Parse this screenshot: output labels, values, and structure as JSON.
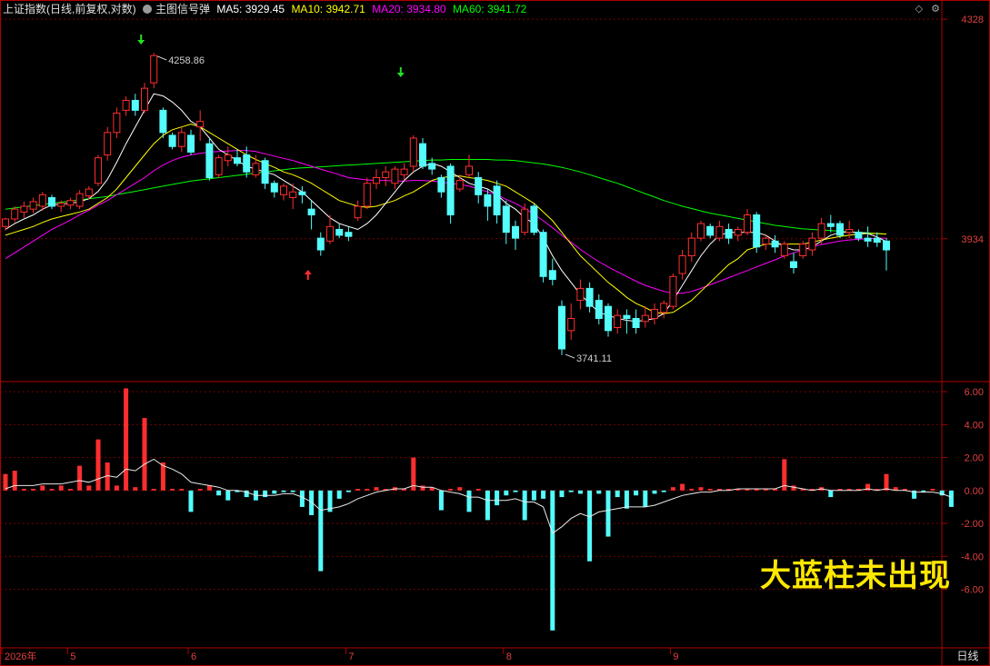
{
  "header": {
    "title": "上证指数(日线,前复权,对数)",
    "indicator_name": "主图信号弹",
    "ma": [
      {
        "label": "MA5: 3929.45",
        "color": "#ffffff"
      },
      {
        "label": "MA10: 3942.71",
        "color": "#ffff00"
      },
      {
        "label": "MA20: 3934.80",
        "color": "#ff00ff"
      },
      {
        "label": "MA60: 3941.72",
        "color": "#00ff00"
      }
    ],
    "tool_icons": [
      "diamond-icon",
      "settings-icon"
    ]
  },
  "price_axis": {
    "ticks": [
      4328,
      3934
    ],
    "tick_labels": [
      "4328",
      "3934"
    ]
  },
  "sub_axis": {
    "ticks": [
      6,
      4,
      2,
      0,
      -2,
      -4,
      -6
    ],
    "tick_labels": [
      "6.00",
      "4.00",
      "2.00",
      "0.00",
      "-2.00",
      "-4.00",
      "-6.00"
    ]
  },
  "time_axis": {
    "labels": [
      {
        "text": "2026年",
        "idx": 0
      },
      {
        "text": "5",
        "idx": 7
      },
      {
        "text": "6",
        "idx": 20
      },
      {
        "text": "7",
        "idx": 37
      },
      {
        "text": "8",
        "idx": 54
      },
      {
        "text": "9",
        "idx": 72
      }
    ],
    "period_label": "日线"
  },
  "annotations": {
    "high_label": "4258.86",
    "low_label": "3741.11",
    "overlay_text": "大蓝柱未出现"
  },
  "colors": {
    "up": "#ff2e2e",
    "down": "#54fcfc",
    "grid": "#7a0000",
    "frame": "#b00000"
  },
  "chart_data": [
    {
      "type": "candlestick",
      "ylim": [
        3700,
        4330
      ],
      "scale": "log",
      "candles": [
        [
          3955,
          3968,
          3948,
          3970
        ],
        [
          3968,
          3985,
          3962,
          3990
        ],
        [
          3980,
          3990,
          3970,
          3998
        ],
        [
          3985,
          3998,
          3978,
          4005
        ],
        [
          3990,
          4010,
          3982,
          4015
        ],
        [
          4005,
          3990,
          3985,
          4010
        ],
        [
          3990,
          3995,
          3980,
          4000
        ],
        [
          3992,
          4000,
          3985,
          4005
        ],
        [
          3990,
          4012,
          3985,
          4018
        ],
        [
          4008,
          4020,
          4002,
          4025
        ],
        [
          4030,
          4075,
          4025,
          4080
        ],
        [
          4080,
          4120,
          4070,
          4130
        ],
        [
          4120,
          4155,
          4110,
          4165
        ],
        [
          4160,
          4178,
          4150,
          4185
        ],
        [
          4178,
          4160,
          4150,
          4190
        ],
        [
          4160,
          4200,
          4155,
          4210
        ],
        [
          4210,
          4260,
          4200,
          4265
        ],
        [
          4160,
          4120,
          4110,
          4165
        ],
        [
          4115,
          4095,
          4090,
          4120
        ],
        [
          4095,
          4120,
          4085,
          4130
        ],
        [
          4115,
          4085,
          4080,
          4125
        ],
        [
          4130,
          4140,
          4105,
          4160
        ],
        [
          4100,
          4040,
          4035,
          4110
        ],
        [
          4045,
          4075,
          4040,
          4080
        ],
        [
          4070,
          4080,
          4060,
          4095
        ],
        [
          4075,
          4065,
          4060,
          4090
        ],
        [
          4080,
          4050,
          4040,
          4095
        ],
        [
          4045,
          4065,
          4040,
          4080
        ],
        [
          4070,
          4030,
          4020,
          4075
        ],
        [
          4030,
          4015,
          4005,
          4035
        ],
        [
          4010,
          4025,
          4000,
          4030
        ],
        [
          4005,
          4015,
          3985,
          4030
        ],
        [
          4015,
          4010,
          3995,
          4025
        ],
        [
          3985,
          3975,
          3950,
          4000
        ],
        [
          3935,
          3915,
          3905,
          3945
        ],
        [
          3930,
          3955,
          3925,
          3975
        ],
        [
          3950,
          3940,
          3935,
          3960
        ],
        [
          3945,
          3938,
          3930,
          3955
        ],
        [
          3970,
          3990,
          3965,
          4000
        ],
        [
          3990,
          4030,
          3985,
          4040
        ],
        [
          4030,
          4040,
          4020,
          4055
        ],
        [
          4040,
          4050,
          4025,
          4060
        ],
        [
          4030,
          4055,
          4020,
          4060
        ],
        [
          4045,
          4055,
          4035,
          4065
        ],
        [
          4060,
          4110,
          4050,
          4115
        ],
        [
          4100,
          4060,
          4055,
          4110
        ],
        [
          4065,
          4055,
          4045,
          4075
        ],
        [
          4040,
          4015,
          4005,
          4045
        ],
        [
          4060,
          3975,
          3960,
          4065
        ],
        [
          4020,
          4035,
          4015,
          4045
        ],
        [
          4045,
          4060,
          4040,
          4080
        ],
        [
          4040,
          4010,
          3995,
          4050
        ],
        [
          4010,
          3990,
          3965,
          4020
        ],
        [
          4025,
          3975,
          3960,
          4035
        ],
        [
          3990,
          3945,
          3925,
          4000
        ],
        [
          3955,
          3935,
          3915,
          3965
        ],
        [
          3945,
          3985,
          3940,
          3995
        ],
        [
          3990,
          3945,
          3940,
          3995
        ],
        [
          3945,
          3870,
          3860,
          3950
        ],
        [
          3880,
          3865,
          3855,
          3900
        ],
        [
          3820,
          3750,
          3740,
          3830
        ],
        [
          3780,
          3800,
          3765,
          3825
        ],
        [
          3830,
          3850,
          3815,
          3865
        ],
        [
          3850,
          3820,
          3810,
          3860
        ],
        [
          3830,
          3800,
          3790,
          3840
        ],
        [
          3820,
          3780,
          3770,
          3825
        ],
        [
          3785,
          3805,
          3775,
          3815
        ],
        [
          3805,
          3800,
          3775,
          3815
        ],
        [
          3800,
          3785,
          3775,
          3815
        ],
        [
          3795,
          3805,
          3785,
          3820
        ],
        [
          3800,
          3815,
          3790,
          3825
        ],
        [
          3810,
          3825,
          3800,
          3830
        ],
        [
          3820,
          3870,
          3815,
          3875
        ],
        [
          3875,
          3905,
          3865,
          3915
        ],
        [
          3905,
          3935,
          3895,
          3945
        ],
        [
          3935,
          3960,
          3930,
          3965
        ],
        [
          3955,
          3940,
          3935,
          3960
        ],
        [
          3935,
          3955,
          3930,
          3965
        ],
        [
          3950,
          3935,
          3925,
          3960
        ],
        [
          3940,
          3950,
          3930,
          3955
        ],
        [
          3945,
          3975,
          3940,
          3985
        ],
        [
          3975,
          3920,
          3910,
          3980
        ],
        [
          3925,
          3935,
          3915,
          3940
        ],
        [
          3930,
          3920,
          3910,
          3940
        ],
        [
          3905,
          3925,
          3900,
          3930
        ],
        [
          3895,
          3885,
          3875,
          3910
        ],
        [
          3905,
          3925,
          3900,
          3930
        ],
        [
          3915,
          3935,
          3905,
          3945
        ],
        [
          3935,
          3960,
          3925,
          3970
        ],
        [
          3960,
          3955,
          3945,
          3975
        ],
        [
          3960,
          3940,
          3935,
          3965
        ],
        [
          3945,
          3950,
          3935,
          3965
        ],
        [
          3945,
          3935,
          3930,
          3950
        ],
        [
          3935,
          3930,
          3920,
          3955
        ],
        [
          3935,
          3928,
          3920,
          3945
        ],
        [
          3930,
          3915,
          3880,
          3935
        ]
      ],
      "ma5": [
        3950,
        3960,
        3968,
        3975,
        3985,
        3992,
        3994,
        3995,
        3998,
        4003,
        4016,
        4037,
        4067,
        4100,
        4130,
        4160,
        4190,
        4186,
        4175,
        4160,
        4140,
        4130,
        4110,
        4090,
        4080,
        4070,
        4060,
        4055,
        4050,
        4045,
        4035,
        4025,
        4015,
        4000,
        3985,
        3970,
        3960,
        3955,
        3950,
        3960,
        3975,
        3995,
        4015,
        4035,
        4050,
        4060,
        4065,
        4060,
        4050,
        4040,
        4030,
        4025,
        4020,
        4010,
        3995,
        3985,
        3970,
        3960,
        3935,
        3905,
        3880,
        3860,
        3840,
        3825,
        3810,
        3805,
        3800,
        3797,
        3795,
        3797,
        3800,
        3808,
        3830,
        3855,
        3880,
        3905,
        3925,
        3940,
        3945,
        3945,
        3945,
        3945,
        3940,
        3930,
        3920,
        3915,
        3915,
        3920,
        3930,
        3940,
        3945,
        3945,
        3945,
        3943,
        3937,
        3929
      ],
      "ma10": [
        3940,
        3945,
        3950,
        3955,
        3962,
        3968,
        3972,
        3976,
        3980,
        3985,
        3995,
        4005,
        4020,
        4040,
        4060,
        4080,
        4100,
        4115,
        4125,
        4130,
        4135,
        4130,
        4120,
        4110,
        4100,
        4090,
        4080,
        4072,
        4065,
        4058,
        4050,
        4045,
        4038,
        4030,
        4020,
        4010,
        4000,
        3995,
        3990,
        3988,
        3990,
        3995,
        4000,
        4008,
        4015,
        4025,
        4035,
        4040,
        4042,
        4043,
        4040,
        4038,
        4035,
        4030,
        4025,
        4015,
        4005,
        3995,
        3980,
        3965,
        3945,
        3925,
        3905,
        3890,
        3875,
        3860,
        3848,
        3835,
        3825,
        3818,
        3810,
        3808,
        3810,
        3820,
        3830,
        3845,
        3860,
        3875,
        3890,
        3900,
        3915,
        3920,
        3925,
        3925,
        3925,
        3925,
        3925,
        3928,
        3932,
        3935,
        3938,
        3940,
        3942,
        3943,
        3943,
        3942
      ],
      "ma20": [
        3900,
        3910,
        3920,
        3930,
        3940,
        3950,
        3958,
        3966,
        3975,
        3983,
        3992,
        4000,
        4010,
        4020,
        4030,
        4040,
        4052,
        4062,
        4070,
        4076,
        4080,
        4083,
        4085,
        4086,
        4087,
        4088,
        4088,
        4086,
        4082,
        4078,
        4074,
        4070,
        4065,
        4060,
        4055,
        4050,
        4045,
        4040,
        4038,
        4036,
        4035,
        4035,
        4034,
        4034,
        4035,
        4035,
        4034,
        4032,
        4030,
        4028,
        4025,
        4020,
        4015,
        4010,
        4002,
        3995,
        3986,
        3976,
        3965,
        3953,
        3940,
        3928,
        3916,
        3905,
        3895,
        3886,
        3878,
        3870,
        3862,
        3855,
        3850,
        3845,
        3842,
        3842,
        3845,
        3850,
        3856,
        3862,
        3868,
        3874,
        3880,
        3886,
        3892,
        3898,
        3905,
        3910,
        3915,
        3920,
        3924,
        3927,
        3930,
        3932,
        3933,
        3934,
        3935,
        3935
      ],
      "ma60": [
        3985,
        3987,
        3989,
        3991,
        3993,
        3995,
        3997,
        3999,
        4001,
        4003,
        4005,
        4007,
        4010,
        4013,
        4016,
        4019,
        4022,
        4025,
        4028,
        4031,
        4034,
        4036,
        4038,
        4040,
        4042,
        4044,
        4046,
        4048,
        4050,
        4052,
        4054,
        4056,
        4057,
        4058,
        4059,
        4060,
        4061,
        4062,
        4063,
        4064,
        4065,
        4066,
        4067,
        4068,
        4069,
        4070,
        4071,
        4071,
        4072,
        4072,
        4072,
        4072,
        4072,
        4071,
        4071,
        4070,
        4068,
        4066,
        4064,
        4061,
        4058,
        4054,
        4050,
        4045,
        4040,
        4035,
        4030,
        4024,
        4018,
        4012,
        4006,
        4000,
        3995,
        3990,
        3986,
        3982,
        3978,
        3975,
        3972,
        3969,
        3966,
        3963,
        3960,
        3957,
        3955,
        3953,
        3951,
        3950,
        3949,
        3948,
        3947,
        3946,
        3945,
        3944,
        3943,
        3942
      ],
      "high_point": {
        "idx": 16,
        "value": 4258.86
      },
      "low_point": {
        "idx": 60,
        "value": 3741.11
      },
      "signals": [
        {
          "idx": 16,
          "dir": "down",
          "pos": "top"
        },
        {
          "idx": 44,
          "dir": "down",
          "pos": "top"
        },
        {
          "idx": 34,
          "dir": "up",
          "pos": "bottom"
        }
      ]
    },
    {
      "type": "bar",
      "ylim": [
        -9.5,
        6.5
      ],
      "values": [
        1.0,
        1.2,
        0.1,
        0.1,
        0.3,
        0.1,
        0.3,
        0.1,
        1.5,
        0.3,
        3.1,
        1.7,
        0.3,
        6.2,
        0.2,
        4.4,
        0.1,
        1.7,
        0.1,
        0.1,
        -1.3,
        0.1,
        0.3,
        -0.3,
        -0.6,
        -0.1,
        -0.4,
        -0.6,
        -0.4,
        -0.2,
        -0.1,
        -0.1,
        -1.0,
        -1.5,
        -4.9,
        -1.3,
        -0.5,
        -0.1,
        0.1,
        0.1,
        0.2,
        0.1,
        0.2,
        0.1,
        2.0,
        0.3,
        0.2,
        -1.2,
        0.1,
        0.2,
        -1.3,
        0.1,
        -1.8,
        -0.9,
        -0.3,
        -0.1,
        -1.8,
        -0.6,
        -0.5,
        -8.5,
        -0.4,
        -0.1,
        -0.2,
        -4.3,
        -0.2,
        -2.8,
        -0.4,
        -1.1,
        -0.3,
        -1.0,
        -0.2,
        -0.1,
        0.2,
        0.4,
        0.1,
        0.2,
        0.1,
        0.1,
        0.1,
        0.1,
        0.1,
        0.1,
        0.1,
        0.1,
        1.9,
        0.3,
        0.1,
        0.1,
        0.2,
        -0.4,
        0.1,
        0.1,
        0.1,
        0.4,
        0.1,
        1.0,
        0.2,
        0.1,
        -0.5,
        -0.1,
        0.1,
        -0.3,
        -1.0
      ],
      "line": [
        0.1,
        0.3,
        0.3,
        0.3,
        0.4,
        0.4,
        0.4,
        0.5,
        0.6,
        0.5,
        0.7,
        0.9,
        0.8,
        1.3,
        1.2,
        1.6,
        1.9,
        1.5,
        1.3,
        1.0,
        0.5,
        0.4,
        0.3,
        0.2,
        0.0,
        0.0,
        -0.1,
        -0.3,
        -0.3,
        -0.3,
        -0.2,
        -0.2,
        -0.4,
        -0.7,
        -1.2,
        -1.1,
        -1.0,
        -0.8,
        -0.5,
        -0.3,
        -0.1,
        0.0,
        0.1,
        0.1,
        0.3,
        0.2,
        0.2,
        0.0,
        -0.1,
        -0.2,
        -0.4,
        -0.4,
        -0.6,
        -0.6,
        -0.6,
        -0.5,
        -0.7,
        -0.7,
        -1.0,
        -2.6,
        -2.2,
        -1.7,
        -1.4,
        -1.6,
        -1.3,
        -1.2,
        -1.1,
        -1.0,
        -1.0,
        -1.0,
        -0.9,
        -0.7,
        -0.5,
        -0.3,
        -0.2,
        -0.1,
        -0.1,
        0.0,
        0.0,
        0.1,
        0.1,
        0.1,
        0.1,
        0.1,
        0.3,
        0.2,
        0.1,
        0.0,
        0.1,
        0.0,
        0.0,
        0.0,
        0.0,
        0.1,
        0.0,
        0.1,
        0.0,
        0.0,
        -0.1,
        -0.1,
        -0.1,
        -0.2,
        -0.4
      ]
    }
  ]
}
